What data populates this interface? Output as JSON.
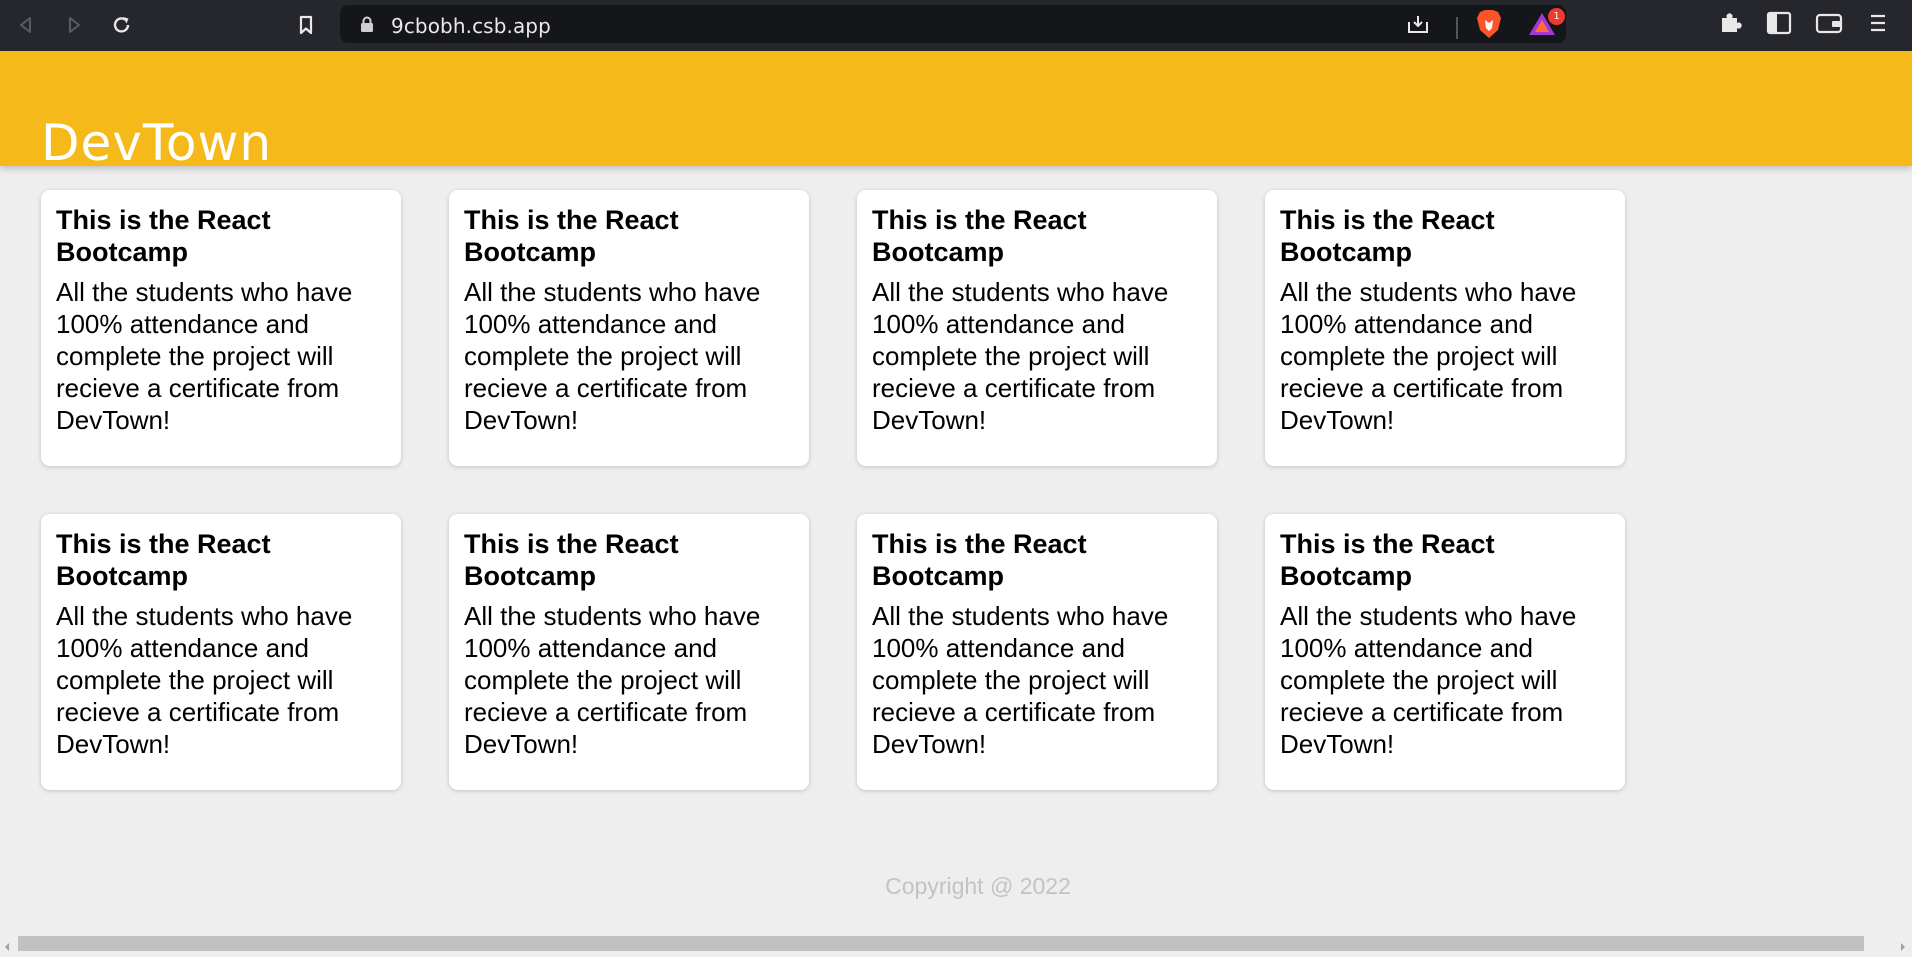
{
  "browser": {
    "url": "9cbobh.csb.app",
    "notification_count": "1"
  },
  "header": {
    "title": "DevTown"
  },
  "cards": [
    {
      "title": "This is the React Bootcamp",
      "body": "All the students who have 100% attendance and complete the project will recieve a certificate from DevTown!"
    },
    {
      "title": "This is the React Bootcamp",
      "body": "All the students who have 100% attendance and complete the project will recieve a certificate from DevTown!"
    },
    {
      "title": "This is the React Bootcamp",
      "body": "All the students who have 100% attendance and complete the project will recieve a certificate from DevTown!"
    },
    {
      "title": "This is the React Bootcamp",
      "body": "All the students who have 100% attendance and complete the project will recieve a certificate from DevTown!"
    },
    {
      "title": "This is the React Bootcamp",
      "body": "All the students who have 100% attendance and complete the project will recieve a certificate from DevTown!"
    },
    {
      "title": "This is the React Bootcamp",
      "body": "All the students who have 100% attendance and complete the project will recieve a certificate from DevTown!"
    },
    {
      "title": "This is the React Bootcamp",
      "body": "All the students who have 100% attendance and complete the project will recieve a certificate from DevTown!"
    },
    {
      "title": "This is the React Bootcamp",
      "body": "All the students who have 100% attendance and complete the project will recieve a certificate from DevTown!"
    }
  ],
  "footer": {
    "copyright": "Copyright @ 2022"
  },
  "colors": {
    "header_bg": "#f5b919",
    "page_bg": "#eeeeee",
    "toolbar_bg": "#26272c"
  },
  "icons": [
    "back-icon",
    "forward-icon",
    "reload-icon",
    "bookmark-icon",
    "lock-icon",
    "download-icon",
    "brave-shields-icon",
    "brave-rewards-icon",
    "extensions-icon",
    "sidebar-icon",
    "wallet-icon",
    "menu-icon"
  ]
}
